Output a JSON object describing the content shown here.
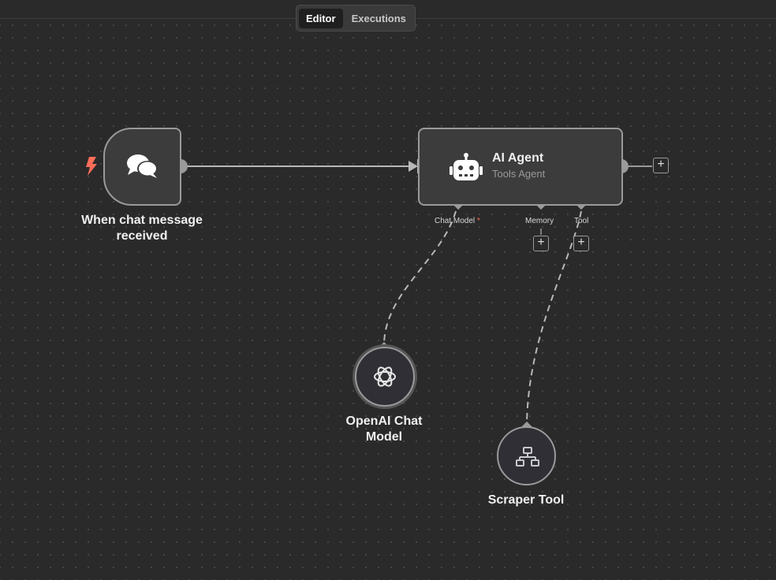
{
  "header": {
    "tabs": [
      {
        "label": "Editor",
        "active": true
      },
      {
        "label": "Executions",
        "active": false
      }
    ]
  },
  "nodes": {
    "trigger": {
      "label_line1": "When chat message",
      "label_line2": "received",
      "icon": "chat-bubbles-icon",
      "badge_icon": "lightning-icon"
    },
    "agent": {
      "title": "AI Agent",
      "subtitle": "Tools Agent",
      "icon": "robot-icon",
      "ports": {
        "chat_model": "Chat Model",
        "chat_model_required": "*",
        "memory": "Memory",
        "tool": "Tool"
      }
    },
    "openai": {
      "label_line1": "OpenAI Chat",
      "label_line2": "Model",
      "icon": "openai-icon"
    },
    "scraper": {
      "label": "Scraper Tool",
      "icon": "network-icon"
    }
  },
  "colors": {
    "background": "#2a2a2a",
    "node_fill": "#3c3c3c",
    "node_border": "#9a9a9a",
    "trigger_bolt": "#ff6d5a",
    "connection": "#b8b8b8"
  }
}
